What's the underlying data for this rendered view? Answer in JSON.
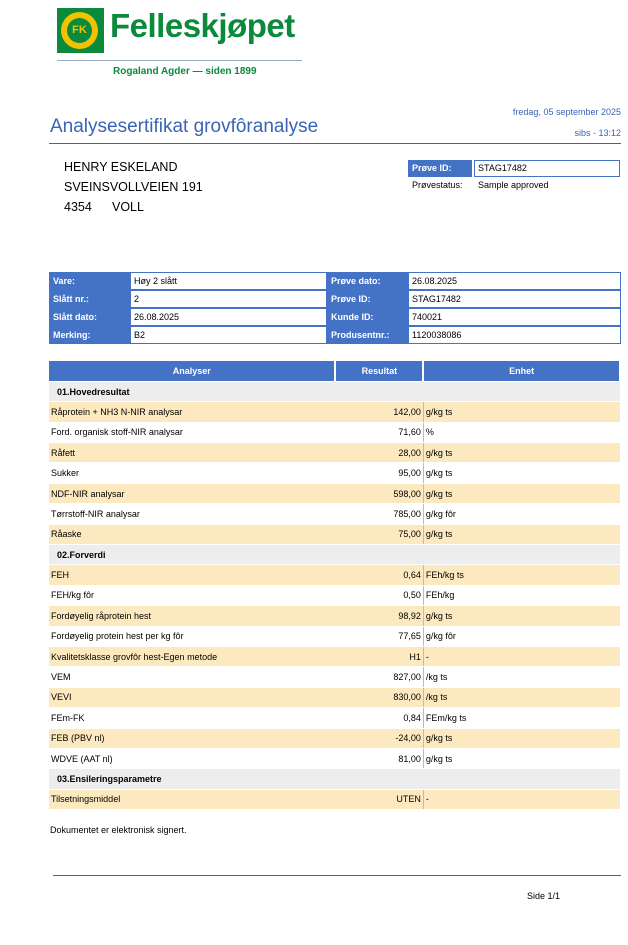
{
  "header": {
    "logo_mark": "FK",
    "brand": "Felleskjøpet",
    "tagline": "Rogaland Agder — siden 1899",
    "date": "fredag, 05 september 2025",
    "signature": "sibs - 13:12",
    "title": "Analysesertifikat grovfôranalyse"
  },
  "address": {
    "name": "HENRY ESKELAND",
    "street": "SVEINSVOLLVEIEN 191",
    "zip": "4354",
    "city": "VOLL"
  },
  "sample_box": {
    "id_label": "Prøve ID:",
    "id_value": "STAG17482",
    "status_label": "Prøvestatus:",
    "status_value": "Sample approved"
  },
  "info": {
    "rows": [
      [
        "Vare:",
        "Høy 2 slått",
        "Prøve dato:",
        "26.08.2025"
      ],
      [
        "Slått nr.:",
        "2",
        "Prøve ID:",
        "STAG17482"
      ],
      [
        "Slått dato:",
        "26.08.2025",
        "Kunde ID:",
        "740021"
      ],
      [
        "Merking:",
        "B2",
        "Produsentnr.:",
        "1120038086"
      ]
    ]
  },
  "results": {
    "headers": [
      "Analyser",
      "Resultat",
      "Enhet"
    ],
    "sections": [
      {
        "title": "01.Hovedresultat",
        "rows": [
          [
            "Råprotein + NH3 N-NIR analysar",
            "142,00",
            "g/kg ts"
          ],
          [
            "Ford. organisk stoff-NIR analysar",
            "71,60",
            "%"
          ],
          [
            "Råfett",
            "28,00",
            "g/kg ts"
          ],
          [
            "Sukker",
            "95,00",
            "g/kg ts"
          ],
          [
            "NDF-NIR analysar",
            "598,00",
            "g/kg ts"
          ],
          [
            "Tørrstoff-NIR analysar",
            "785,00",
            "g/kg fôr"
          ],
          [
            "Råaske",
            "75,00",
            "g/kg ts"
          ]
        ]
      },
      {
        "title": "02.Forverdi",
        "rows": [
          [
            "FEH",
            "0,64",
            "FEh/kg ts"
          ],
          [
            "FEH/kg fôr",
            "0,50",
            "FEh/kg"
          ],
          [
            "Fordøyelig råprotein hest",
            "98,92",
            "g/kg ts"
          ],
          [
            "Fordøyelig protein hest per kg fôr",
            "77,65",
            "g/kg fôr"
          ],
          [
            "Kvalitetsklasse grovfôr hest-Egen metode",
            "H1",
            "-"
          ],
          [
            "VEM",
            "827,00",
            "/kg ts"
          ],
          [
            "VEVI",
            "830,00",
            "/kg ts"
          ],
          [
            "FEm-FK",
            "0,84",
            "FEm/kg ts"
          ],
          [
            "FEB (PBV nl)",
            "-24,00",
            "g/kg ts"
          ],
          [
            "WDVE (AAT nl)",
            "81,00",
            "g/kg ts"
          ]
        ]
      },
      {
        "title": "03.Ensileringsparametre",
        "rows": [
          [
            "Tilsetningsmiddel",
            "UTEN",
            "-"
          ]
        ]
      }
    ]
  },
  "footer": {
    "signed": "Dokumentet er elektronisk signert.",
    "page": "Side 1/1"
  },
  "colors": {
    "brand_green": "#0b8a3c",
    "accent_blue": "#4472c4",
    "row_highlight": "#fde9bf"
  }
}
